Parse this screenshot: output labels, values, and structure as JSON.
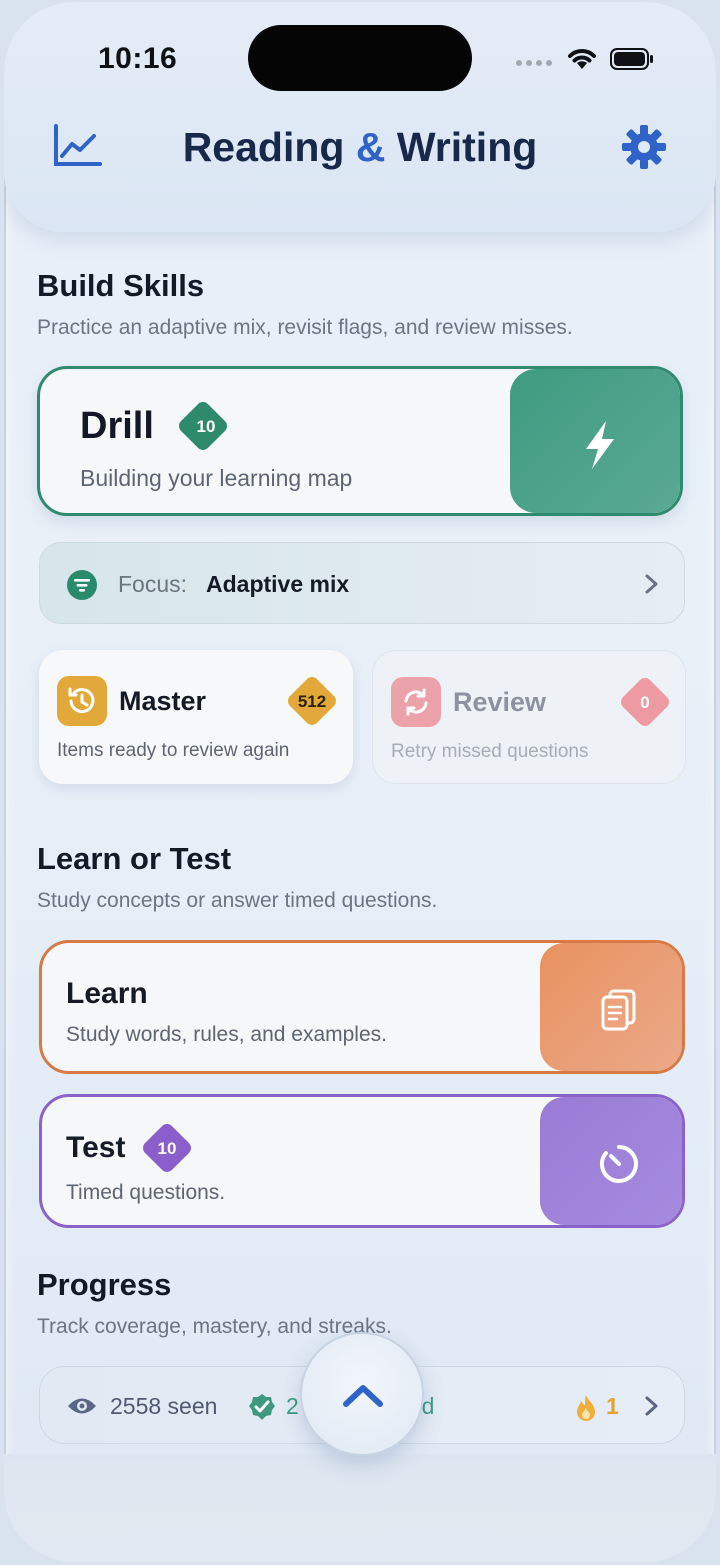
{
  "status": {
    "time": "10:16"
  },
  "header": {
    "title_pre": "Reading ",
    "title_amp": "&",
    "title_post": " Writing"
  },
  "build": {
    "title": "Build Skills",
    "subtitle": "Practice an adaptive mix, revisit flags, and review misses.",
    "drill": {
      "label": "Drill",
      "badge": "10",
      "subtitle": "Building your learning map"
    },
    "focus": {
      "label": "Focus:",
      "value": "Adaptive mix"
    },
    "master": {
      "label": "Master",
      "badge": "512",
      "subtitle": "Items ready to review again"
    },
    "review": {
      "label": "Review",
      "badge": "0",
      "subtitle": "Retry missed questions"
    }
  },
  "learn_test": {
    "title": "Learn or Test",
    "subtitle": "Study concepts or answer timed questions.",
    "learn": {
      "label": "Learn",
      "subtitle": "Study words, rules, and examples."
    },
    "test": {
      "label": "Test",
      "badge": "10",
      "subtitle": "Timed questions."
    }
  },
  "progress": {
    "title": "Progress",
    "subtitle": "Track coverage, mastery, and streaks.",
    "seen": "2558 seen",
    "mastered": "2",
    "mastered_tail": "ed",
    "streak": "1"
  },
  "colors": {
    "drill": "#3f9b80",
    "learn": "#e8925f",
    "test": "#9a7bd6",
    "master": "#e2a93a",
    "review": "#e67a86"
  }
}
